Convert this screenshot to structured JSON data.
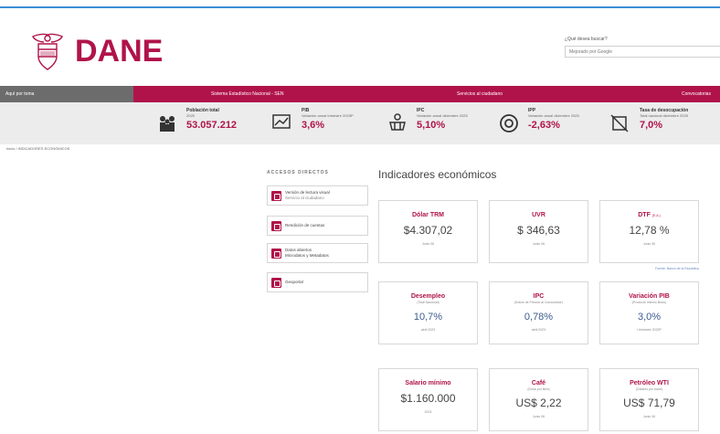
{
  "brand": {
    "name": "DANE",
    "color": "#b0134a"
  },
  "search": {
    "label": "¿Qué desea buscar?",
    "placeholder": "Mejorado por Google"
  },
  "nav": {
    "items": [
      {
        "label": "Aquí por toma"
      },
      {
        "label": "Sistema Estadístico Nacional - SEN"
      },
      {
        "label": "Servicios al ciudadano"
      },
      {
        "label": "Convocatorias"
      }
    ]
  },
  "stats": [
    {
      "icon": "population-icon",
      "title": "Población total",
      "sub": "2025",
      "value": "53.057.212"
    },
    {
      "icon": "gdp-icon",
      "title": "PIB",
      "sub": "Variación anual trimestre 2025P",
      "value": "3,6%"
    },
    {
      "icon": "cart-icon",
      "title": "IPC",
      "sub": "Variación anual diciembre 2025",
      "value": "5,10%"
    },
    {
      "icon": "ipp-icon",
      "title": "IPP",
      "sub": "Variación anual diciembre 2025",
      "value": "-2,63%"
    },
    {
      "icon": "unemployment-icon",
      "title": "Tasa de desocupación",
      "sub": "Total nacional diciembre 2025",
      "value": "7,0%"
    }
  ],
  "breadcrumb": "Inicio / INDICADORES ECONÓMICOS",
  "direct_access": {
    "title": "ACCESOS DIRECTOS",
    "items": [
      {
        "label": "Versión de lectura visual",
        "sub": "Servicio al ciudadano"
      },
      {
        "label": "Rendición de cuentas",
        "sub": ""
      },
      {
        "label": "Datos abiertos",
        "sub": "Microdatos y Metadatos"
      },
      {
        "label": "Geoportal",
        "sub": ""
      }
    ]
  },
  "indicators": {
    "title": "Indicadores económicos",
    "note": "Fuente: Banco de la República",
    "cards": [
      {
        "name": "Dólar TRM",
        "tag": "",
        "sub": "",
        "value": "$4.307,02",
        "date": "Junio 06"
      },
      {
        "name": "UVR",
        "tag": "",
        "sub": "",
        "value": "$ 346,63",
        "date": "Junio 06"
      },
      {
        "name": "DTF",
        "tag": "(E.A.)",
        "sub": "",
        "value": "12,78 %",
        "date": "Junio 06"
      },
      {
        "name": "Desempleo",
        "tag": "",
        "sub": "(Total Nacional)",
        "value": "10,7%",
        "date": "abril 2023"
      },
      {
        "name": "IPC",
        "tag": "",
        "sub": "(Índice de Precios al Consumidor)",
        "value": "0,78%",
        "date": "abril 2023"
      },
      {
        "name": "Variación PIB",
        "tag": "",
        "sub": "(Producto Interno Bruto)",
        "value": "3,0%",
        "date": "I trimestre 2023P"
      },
      {
        "name": "Salario mínimo",
        "tag": "",
        "sub": "",
        "value": "$1.160.000",
        "date": "2023"
      },
      {
        "name": "Café",
        "tag": "",
        "sub": "(Dólar por libra)",
        "value": "US$ 2,22",
        "date": "Junio 06"
      },
      {
        "name": "Petróleo WTI",
        "tag": "",
        "sub": "(Dólares por barril)",
        "value": "US$ 71,79",
        "date": "Junio 06"
      }
    ]
  }
}
